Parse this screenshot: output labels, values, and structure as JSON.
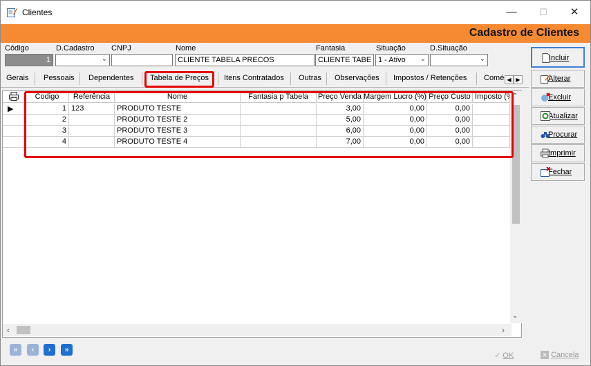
{
  "window": {
    "title": "Clientes",
    "minimize": "—",
    "maximize": "☐",
    "close": "✕"
  },
  "banner": {
    "title": "Cadastro de Clientes"
  },
  "fields": {
    "codigo": {
      "label": "Código",
      "value": "1"
    },
    "dcadastro": {
      "label": "D.Cadastro",
      "value": ""
    },
    "cnpj": {
      "label": "CNPJ",
      "value": ""
    },
    "nome": {
      "label": "Nome",
      "value": "CLIENTE TABELA PRECOS"
    },
    "fantasia": {
      "label": "Fantasia",
      "value": "CLIENTE TABE"
    },
    "situacao": {
      "label": "Situação",
      "value": "1 - Ativo"
    },
    "dsituacao": {
      "label": "D.Situação",
      "value": ""
    }
  },
  "tabs": [
    "Gerais",
    "Pessoais",
    "Dependentes",
    "Tabela de Preços",
    "Itens Contratados",
    "Outras",
    "Observações",
    "Impostos / Retenções",
    "Comé"
  ],
  "grid": {
    "columns": [
      "Codigo",
      "Referência",
      "Nome",
      "Fantasia p Tabela",
      "Preço Venda",
      "Margem Lucro (%)",
      "Preço Custo",
      "Imposto (%"
    ],
    "rows": [
      {
        "codigo": "1",
        "referencia": "123",
        "nome": "PRODUTO TESTE",
        "fantasia": "",
        "preco_venda": "3,00",
        "margem": "0,00",
        "preco_custo": "0,00",
        "imposto": ""
      },
      {
        "codigo": "2",
        "referencia": "",
        "nome": "PRODUTO TESTE 2",
        "fantasia": "",
        "preco_venda": "5,00",
        "margem": "0,00",
        "preco_custo": "0,00",
        "imposto": ""
      },
      {
        "codigo": "3",
        "referencia": "",
        "nome": "PRODUTO TESTE 3",
        "fantasia": "",
        "preco_venda": "6,00",
        "margem": "0,00",
        "preco_custo": "0,00",
        "imposto": ""
      },
      {
        "codigo": "4",
        "referencia": "",
        "nome": "PRODUTO TESTE 4",
        "fantasia": "",
        "preco_venda": "7,00",
        "margem": "0,00",
        "preco_custo": "0,00",
        "imposto": ""
      }
    ]
  },
  "actions": {
    "incluir": "Incluir",
    "alterar": "Alterar",
    "excluir": "Excluir",
    "atualizar": "Atualizar",
    "procurar": "Procurar",
    "imprimir": "Imprimir",
    "fechar": "Fechar"
  },
  "footer": {
    "ok": "OK",
    "cancela": "Cancela"
  },
  "colors": {
    "banner": "#f58a33",
    "highlight": "#e60000",
    "nav": "#1f6fd0"
  }
}
